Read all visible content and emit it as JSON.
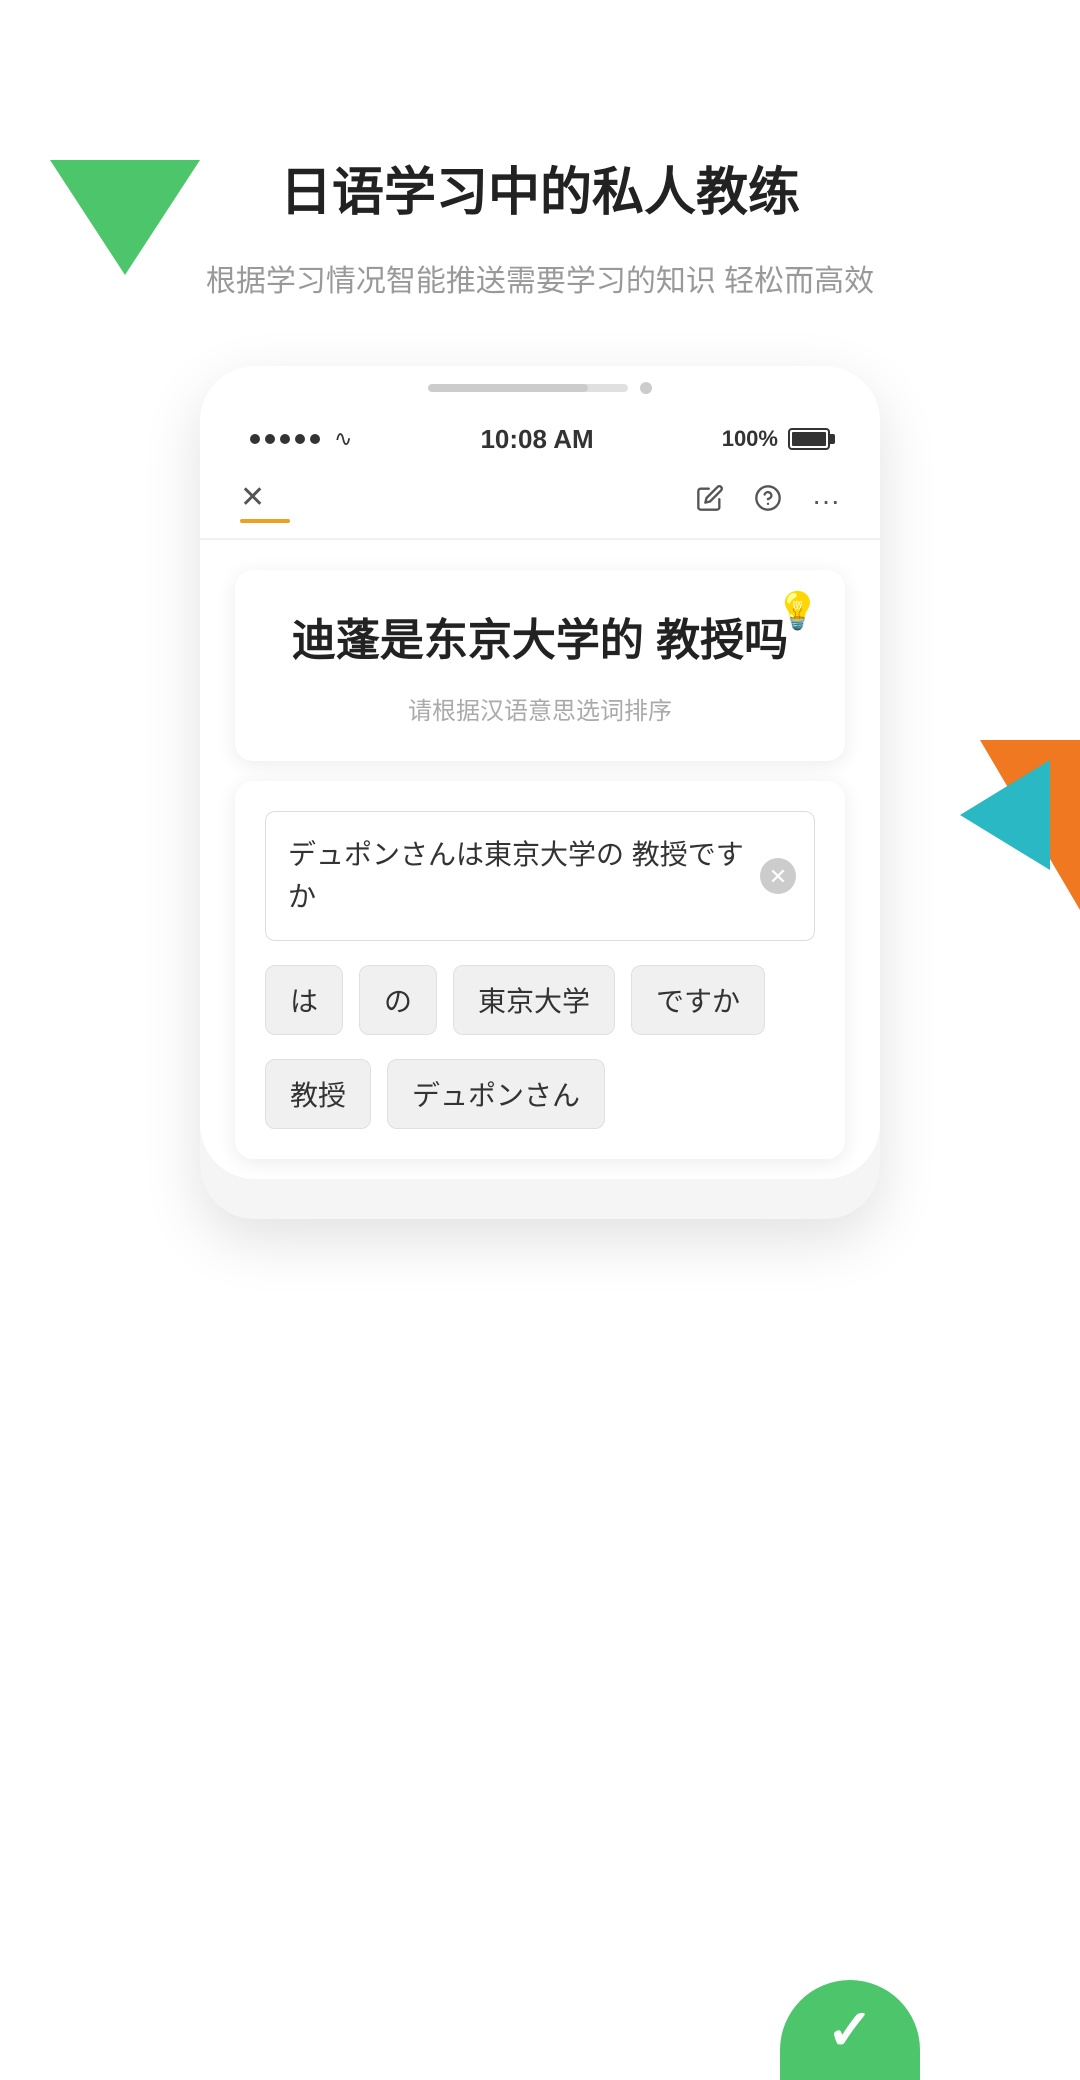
{
  "app": {
    "title": "日语学习中的私人教练",
    "subtitle": "根据学习情况智能推送需要学习的知识\n轻松而高效"
  },
  "status_bar": {
    "time": "10:08 AM",
    "battery": "100%"
  },
  "toolbar": {
    "close_icon": "✕",
    "edit_icon": "✎",
    "help_icon": "?",
    "more_icon": "···"
  },
  "question": {
    "text": "迪蓬是东京大学的\n教授吗",
    "hint": "请根据汉语意思选词排序",
    "bulb": "💡"
  },
  "answer": {
    "current_answer": "デュポンさんは東京大学の\n教授ですか",
    "word_chips": [
      {
        "id": 1,
        "label": "は"
      },
      {
        "id": 2,
        "label": "の"
      },
      {
        "id": 3,
        "label": "東京大学"
      },
      {
        "id": 4,
        "label": "ですか"
      },
      {
        "id": 5,
        "label": "教授"
      },
      {
        "id": 6,
        "label": "デュポンさん"
      }
    ]
  },
  "bottom_check": "✓"
}
